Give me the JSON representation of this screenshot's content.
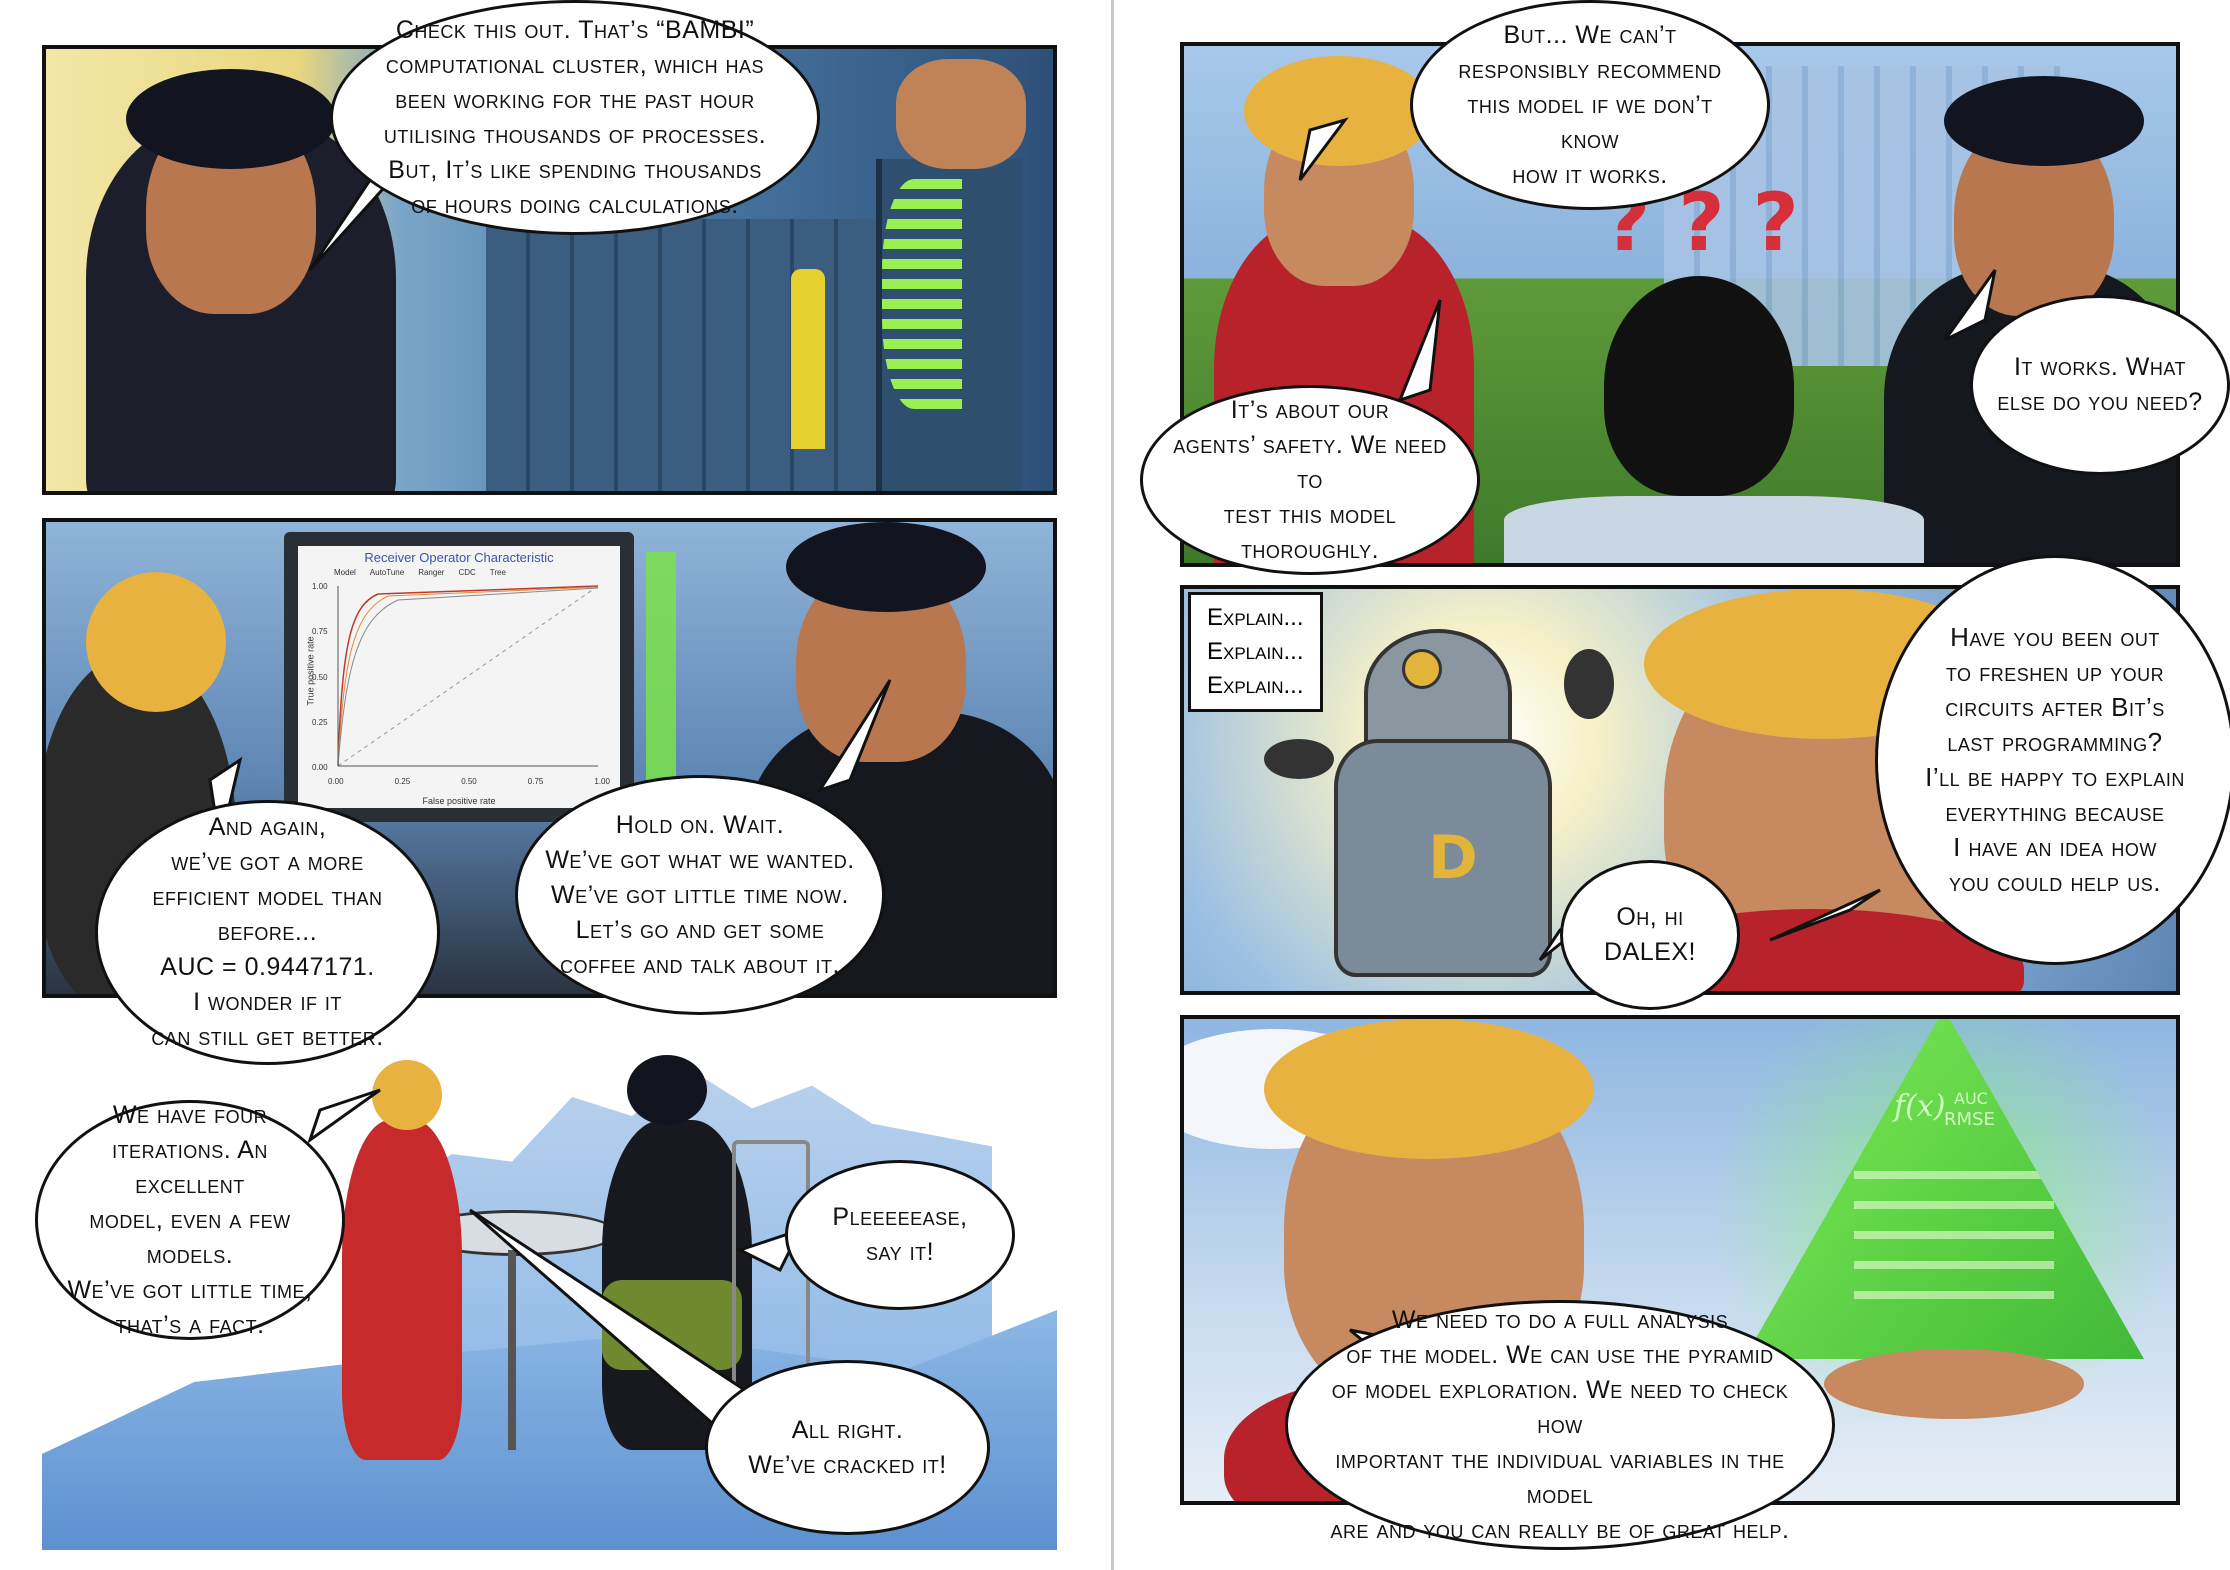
{
  "colors": {
    "ink": "#111111",
    "sky": "#8db8e6",
    "cluster_blue": "#3e6a96",
    "neon_green": "#7be24a",
    "red_jacket": "#c62a2a",
    "blond": "#e7b23f",
    "skin": "#b9774f",
    "pyramid_green": "#5fe53c"
  },
  "left_page": {
    "panel1": {
      "bubble": "Check this out. That’s “BAMBI” computational cluster, which has been working for the past hour utilising thousands of processes. But, It’s like spending thousands of hours doing calculations."
    },
    "panel2": {
      "bubble_left": "And again,\nwe’ve got a more\nefficient model than before...\nAUC = 0.9447171.\nI wonder if it\ncan still get better.",
      "bubble_right": "Hold on. Wait.\nWe’ve got what we wanted.\nWe’ve got little time now.\nLet’s go and get some\ncoffee and talk about it.",
      "roc": {
        "title": "Receiver Operator Characteristic",
        "legend": [
          "Model",
          "AutoTune",
          "Ranger",
          "CDC",
          "Tree"
        ],
        "xlabel": "False positive rate",
        "ylabel": "True positive rate",
        "xticks": [
          "0.00",
          "0.25",
          "0.50",
          "0.75",
          "1.00"
        ],
        "yticks": [
          "0.00",
          "0.25",
          "0.50",
          "0.75",
          "1.00"
        ]
      }
    },
    "panel3": {
      "bubble_left": "We have four\niterations. An excellent\nmodel, even a few models.\nWe’ve got little time,\nthat’s a fact.",
      "bubble_right_top": "Pleeeeease,\nsay it!",
      "bubble_right_bottom": "All right.\nWe’ve cracked it!"
    }
  },
  "right_page": {
    "panel1": {
      "bubble_top": "But... We can’t\nresponsibly recommend\nthis model if we don’t know\nhow it works.",
      "bubble_left": "It’s about our\nagents’ safety. We need to\ntest this model thoroughly.",
      "bubble_right": "It works. What\nelse do you need?"
    },
    "panel2": {
      "caption_lines": [
        "Explain...",
        "Explain...",
        "Explain..."
      ],
      "bubble_small": "Oh, hi\nDALEX!",
      "bubble_big": "Have you been out\nto freshen up your\ncircuits after Bit’s\nlast programming?\nI’ll be happy to explain\neverything because\nI have an idea how\nyou could help us.",
      "robot_letter": "D"
    },
    "panel3": {
      "bubble": "We need to do a full analysis\nof the model. We can use the pyramid\nof model exploration. We need to check how\nimportant the individual variables in the model\nare and you can really be of great help.",
      "pyramid_labels": [
        "f(x)",
        "AUC",
        "RMSE"
      ]
    }
  }
}
